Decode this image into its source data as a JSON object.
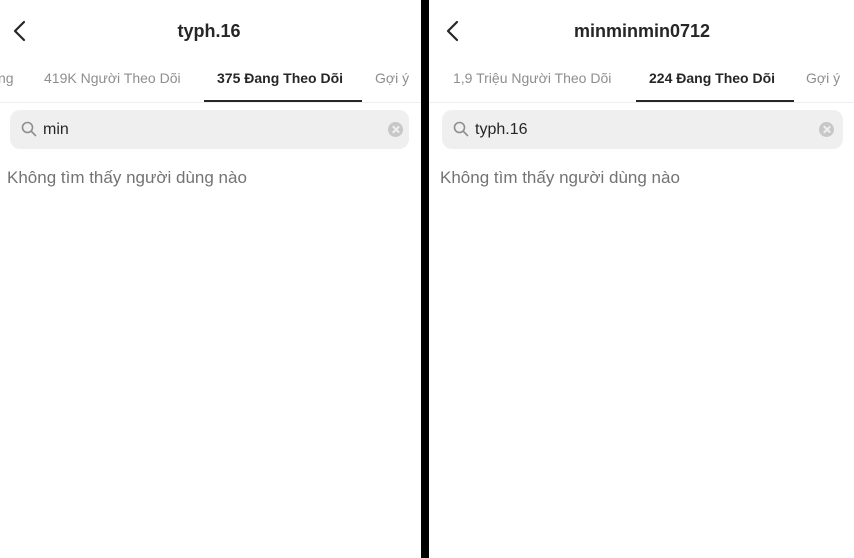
{
  "left": {
    "title": "typh.16",
    "tabs": [
      {
        "label": "ng"
      },
      {
        "label": "419K Người Theo Dõi"
      },
      {
        "label": "375 Đang Theo Dõi"
      },
      {
        "label": "Gợi ý"
      }
    ],
    "search_value": "min",
    "empty_message": "Không tìm thấy người dùng nào"
  },
  "right": {
    "title": "minminmin0712",
    "tabs": [
      {
        "label": "1,9 Triệu Người Theo Dõi"
      },
      {
        "label": "224 Đang Theo Dõi"
      },
      {
        "label": "Gợi ý"
      }
    ],
    "search_value": "typh.16",
    "empty_message": "Không tìm thấy người dùng nào"
  },
  "icons": [
    "back-arrow-icon",
    "search-icon",
    "clear-icon"
  ]
}
